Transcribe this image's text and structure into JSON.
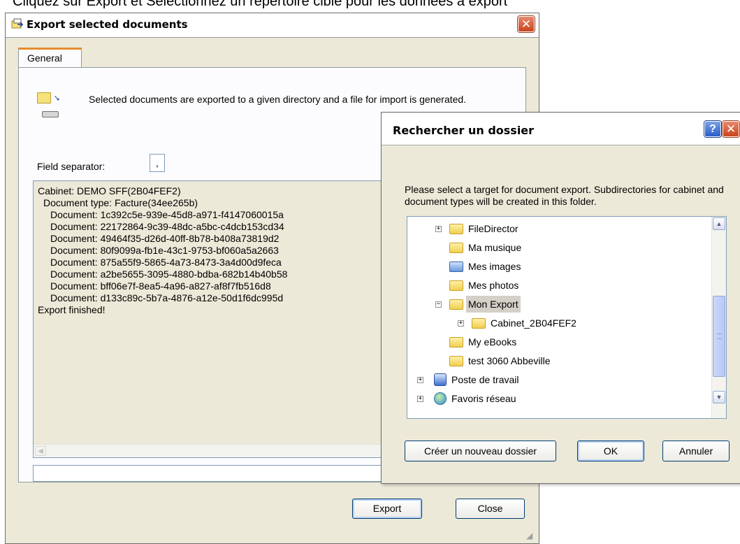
{
  "caption": "Cliquez sur Export et Sélectionnez un répertoire cible pour les données à export",
  "main_dialog": {
    "title": "Export selected documents",
    "close_glyph": "✕",
    "tab_general": "General",
    "info_text": "Selected documents are exported to a given directory and a file for import is generated.",
    "field_separator_label": "Field separator:",
    "field_separator_value": ",",
    "log_lines": [
      "Cabinet: DEMO SFF(2B04FEF2)",
      "  Document type: Facture(34ee265b)",
      "    Document: 1c392c5e-939e-45d8-a971-f4147060015a",
      "    Document: 22172864-9c39-48dc-a5bc-c4dcb153cd34",
      "    Document: 49464f35-d26d-40ff-8b78-b408a73819d2",
      "    Document: 80f9099a-fb1e-43c1-9753-bf060a5a2663",
      "    Document: 875a55f9-5865-4a73-8473-3a4d00d9feca",
      "    Document: a2be5655-3095-4880-bdba-682b14b40b58",
      "    Document: bff06e7f-8ea5-4a96-a827-af8f7fb516d8",
      "    Document: d133c89c-5b7a-4876-a12e-50d1f6dc995d",
      "Export finished!"
    ],
    "export_button": "Export",
    "close_button": "Close"
  },
  "browse_dialog": {
    "title": "Rechercher un dossier",
    "help_glyph": "?",
    "close_glyph": "✕",
    "description": "Please select a target for document export. Subdirectories for cabinet and document types will be created in this folder.",
    "tree_items": [
      {
        "label": "FileDirector",
        "expander": "+"
      },
      {
        "label": "Ma musique",
        "expander": ""
      },
      {
        "label": "Mes images",
        "expander": ""
      },
      {
        "label": "Mes photos",
        "expander": ""
      },
      {
        "label": "Mon Export",
        "expander": "−",
        "selected": true
      },
      {
        "label": "Cabinet_2B04FEF2",
        "expander": "+"
      },
      {
        "label": "My eBooks",
        "expander": ""
      },
      {
        "label": "test 3060 Abbeville",
        "expander": ""
      },
      {
        "label": "Poste de travail",
        "expander": "+"
      },
      {
        "label": "Favoris réseau",
        "expander": "+"
      }
    ],
    "new_folder_button": "Créer un nouveau dossier",
    "ok_button": "OK",
    "cancel_button": "Annuler"
  }
}
